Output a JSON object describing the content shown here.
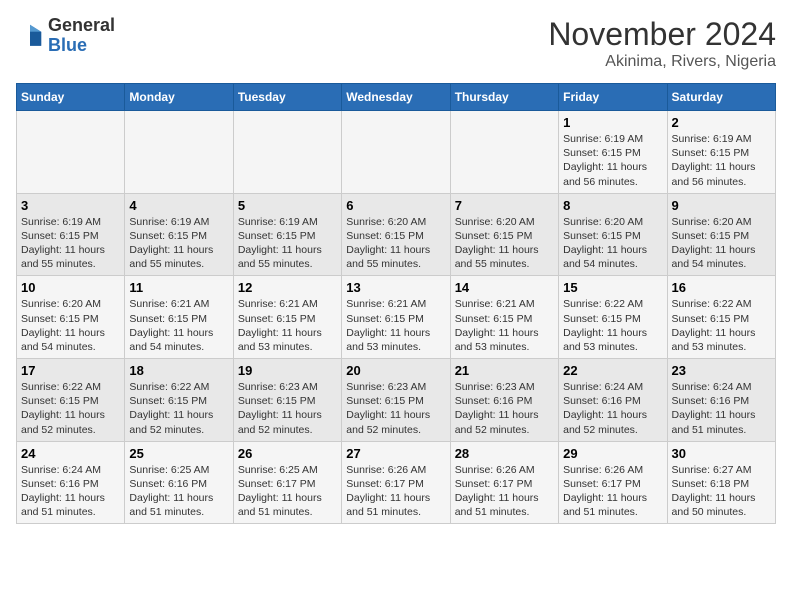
{
  "header": {
    "logo": {
      "general": "General",
      "blue": "Blue"
    },
    "month": "November 2024",
    "location": "Akinima, Rivers, Nigeria"
  },
  "weekdays": [
    "Sunday",
    "Monday",
    "Tuesday",
    "Wednesday",
    "Thursday",
    "Friday",
    "Saturday"
  ],
  "weeks": [
    [
      {
        "day": "",
        "info": ""
      },
      {
        "day": "",
        "info": ""
      },
      {
        "day": "",
        "info": ""
      },
      {
        "day": "",
        "info": ""
      },
      {
        "day": "",
        "info": ""
      },
      {
        "day": "1",
        "info": "Sunrise: 6:19 AM\nSunset: 6:15 PM\nDaylight: 11 hours and 56 minutes."
      },
      {
        "day": "2",
        "info": "Sunrise: 6:19 AM\nSunset: 6:15 PM\nDaylight: 11 hours and 56 minutes."
      }
    ],
    [
      {
        "day": "3",
        "info": "Sunrise: 6:19 AM\nSunset: 6:15 PM\nDaylight: 11 hours and 55 minutes."
      },
      {
        "day": "4",
        "info": "Sunrise: 6:19 AM\nSunset: 6:15 PM\nDaylight: 11 hours and 55 minutes."
      },
      {
        "day": "5",
        "info": "Sunrise: 6:19 AM\nSunset: 6:15 PM\nDaylight: 11 hours and 55 minutes."
      },
      {
        "day": "6",
        "info": "Sunrise: 6:20 AM\nSunset: 6:15 PM\nDaylight: 11 hours and 55 minutes."
      },
      {
        "day": "7",
        "info": "Sunrise: 6:20 AM\nSunset: 6:15 PM\nDaylight: 11 hours and 55 minutes."
      },
      {
        "day": "8",
        "info": "Sunrise: 6:20 AM\nSunset: 6:15 PM\nDaylight: 11 hours and 54 minutes."
      },
      {
        "day": "9",
        "info": "Sunrise: 6:20 AM\nSunset: 6:15 PM\nDaylight: 11 hours and 54 minutes."
      }
    ],
    [
      {
        "day": "10",
        "info": "Sunrise: 6:20 AM\nSunset: 6:15 PM\nDaylight: 11 hours and 54 minutes."
      },
      {
        "day": "11",
        "info": "Sunrise: 6:21 AM\nSunset: 6:15 PM\nDaylight: 11 hours and 54 minutes."
      },
      {
        "day": "12",
        "info": "Sunrise: 6:21 AM\nSunset: 6:15 PM\nDaylight: 11 hours and 53 minutes."
      },
      {
        "day": "13",
        "info": "Sunrise: 6:21 AM\nSunset: 6:15 PM\nDaylight: 11 hours and 53 minutes."
      },
      {
        "day": "14",
        "info": "Sunrise: 6:21 AM\nSunset: 6:15 PM\nDaylight: 11 hours and 53 minutes."
      },
      {
        "day": "15",
        "info": "Sunrise: 6:22 AM\nSunset: 6:15 PM\nDaylight: 11 hours and 53 minutes."
      },
      {
        "day": "16",
        "info": "Sunrise: 6:22 AM\nSunset: 6:15 PM\nDaylight: 11 hours and 53 minutes."
      }
    ],
    [
      {
        "day": "17",
        "info": "Sunrise: 6:22 AM\nSunset: 6:15 PM\nDaylight: 11 hours and 52 minutes."
      },
      {
        "day": "18",
        "info": "Sunrise: 6:22 AM\nSunset: 6:15 PM\nDaylight: 11 hours and 52 minutes."
      },
      {
        "day": "19",
        "info": "Sunrise: 6:23 AM\nSunset: 6:15 PM\nDaylight: 11 hours and 52 minutes."
      },
      {
        "day": "20",
        "info": "Sunrise: 6:23 AM\nSunset: 6:15 PM\nDaylight: 11 hours and 52 minutes."
      },
      {
        "day": "21",
        "info": "Sunrise: 6:23 AM\nSunset: 6:16 PM\nDaylight: 11 hours and 52 minutes."
      },
      {
        "day": "22",
        "info": "Sunrise: 6:24 AM\nSunset: 6:16 PM\nDaylight: 11 hours and 52 minutes."
      },
      {
        "day": "23",
        "info": "Sunrise: 6:24 AM\nSunset: 6:16 PM\nDaylight: 11 hours and 51 minutes."
      }
    ],
    [
      {
        "day": "24",
        "info": "Sunrise: 6:24 AM\nSunset: 6:16 PM\nDaylight: 11 hours and 51 minutes."
      },
      {
        "day": "25",
        "info": "Sunrise: 6:25 AM\nSunset: 6:16 PM\nDaylight: 11 hours and 51 minutes."
      },
      {
        "day": "26",
        "info": "Sunrise: 6:25 AM\nSunset: 6:17 PM\nDaylight: 11 hours and 51 minutes."
      },
      {
        "day": "27",
        "info": "Sunrise: 6:26 AM\nSunset: 6:17 PM\nDaylight: 11 hours and 51 minutes."
      },
      {
        "day": "28",
        "info": "Sunrise: 6:26 AM\nSunset: 6:17 PM\nDaylight: 11 hours and 51 minutes."
      },
      {
        "day": "29",
        "info": "Sunrise: 6:26 AM\nSunset: 6:17 PM\nDaylight: 11 hours and 51 minutes."
      },
      {
        "day": "30",
        "info": "Sunrise: 6:27 AM\nSunset: 6:18 PM\nDaylight: 11 hours and 50 minutes."
      }
    ]
  ]
}
